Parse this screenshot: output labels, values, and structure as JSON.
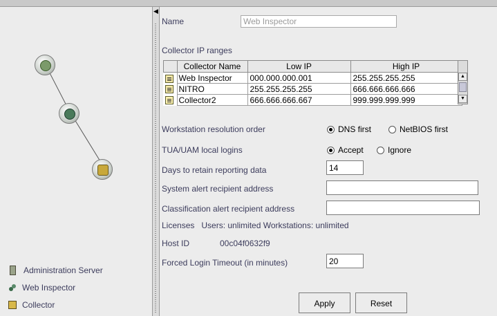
{
  "left_panel": {
    "legend": [
      {
        "label": "Administration Server",
        "icon": "server-icon"
      },
      {
        "label": "Web Inspector",
        "icon": "web-inspector-icon"
      },
      {
        "label": "Collector",
        "icon": "collector-icon"
      }
    ]
  },
  "form": {
    "name_label": "Name",
    "name_value": "Web Inspector",
    "collector_ranges_label": "Collector IP ranges",
    "table": {
      "columns": [
        "Collector Name",
        "Low IP",
        "High IP"
      ],
      "rows": [
        {
          "name": "Web Inspector",
          "low": "000.000.000.001",
          "high": "255.255.255.255"
        },
        {
          "name": "NITRO",
          "low": "255.255.255.255",
          "high": "666.666.666.666"
        },
        {
          "name": "Collector2",
          "low": "666.666.666.667",
          "high": "999.999.999.999"
        }
      ]
    },
    "resolution_label": "Workstation resolution order",
    "resolution_options": [
      "DNS first",
      "NetBIOS first"
    ],
    "resolution_selected": "DNS first",
    "logins_label": "TUA/UAM local logins",
    "logins_options": [
      "Accept",
      "Ignore"
    ],
    "logins_selected": "Accept",
    "retain_label": "Days to retain reporting data",
    "retain_value": "14",
    "system_alert_label": "System alert recipient address",
    "system_alert_value": "",
    "class_alert_label": "Classification alert recipient address",
    "class_alert_value": "",
    "licenses_text": "Licenses   Users: unlimited Workstations: unlimited",
    "host_id_label": "Host ID",
    "host_id_value": "00c04f0632f9",
    "timeout_label": "Forced Login Timeout (in minutes)",
    "timeout_value": "20",
    "apply_label": "Apply",
    "reset_label": "Reset"
  },
  "colors": {
    "label": "#3c3c5c",
    "background": "#ececec"
  }
}
